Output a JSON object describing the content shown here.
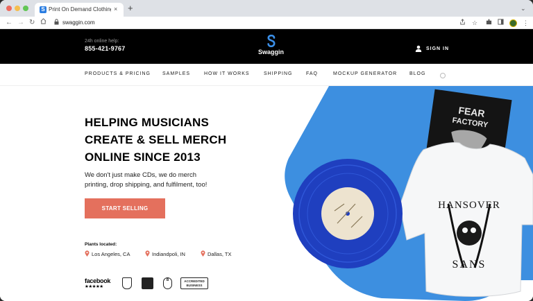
{
  "browser": {
    "tab_title": "Print On Demand Clothing, Ho",
    "tab_favicon": "S",
    "tab_close": "×",
    "new_tab": "+",
    "url": "swaggin.com",
    "icons": [
      "back-icon",
      "forward-icon",
      "reload-icon",
      "home-icon",
      "lock-icon",
      "share-icon",
      "star-icon",
      "extensions-icon",
      "sidepanel-icon",
      "profile-avatar",
      "menu-icon"
    ]
  },
  "header": {
    "help_label": "24h online help:",
    "phone": "855-421-9767",
    "brand": "Swaggin",
    "signin": "SIGN IN",
    "colors": {
      "background": "#000000",
      "brand_mark": "#3b8fe8"
    }
  },
  "nav": {
    "items": [
      {
        "label": "PRODUCTS & PRICING"
      },
      {
        "label": "SAMPLES"
      },
      {
        "label": "HOW IT WORKS"
      },
      {
        "label": "SHIPPING"
      },
      {
        "label": "FAQ"
      },
      {
        "label": "MOCKUP GENERATOR"
      },
      {
        "label": "BLOG"
      }
    ]
  },
  "hero": {
    "headline_lines": [
      "HELPING MUSICIANS",
      "CREATE & SELL MERCH",
      "ONLINE SINCE 2013"
    ],
    "subcopy_lines": [
      "We don't just make CDs, we do merch",
      "printing, drop shipping, and fulfilment, too!"
    ],
    "cta_label": "START SELLING",
    "plants_label": "Plants located:",
    "locations": [
      {
        "label": "Los Angeles, CA"
      },
      {
        "label": "Indiandpoli, IN"
      },
      {
        "label": "Dallas, TX"
      }
    ],
    "colors": {
      "cta": "#e4705d",
      "accent_blue": "#3d8fe0",
      "vinyl": "#1f3fbf"
    }
  },
  "trust": {
    "facebook_word": "facebook",
    "facebook_stars": "★★★★★",
    "bbb_lines": [
      "ACCREDITED",
      "BUSINESS"
    ]
  },
  "artwork": {
    "album_text": [
      "FEAR",
      "FACTORY"
    ],
    "shirt_text_top": "HANSOVER",
    "shirt_text_bottom": "SANS"
  }
}
